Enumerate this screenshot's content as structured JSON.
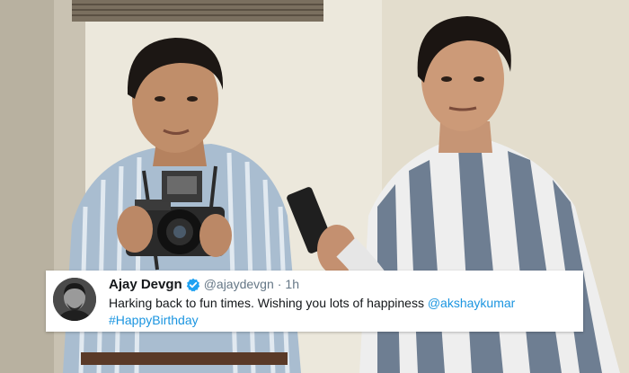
{
  "tweet": {
    "author_name": "Ajay Devgn",
    "handle": "@ajaydevgn",
    "separator": "·",
    "time": "1h",
    "text": "Harking back to fun times. Wishing you lots of happiness",
    "mention": "@akshaykumar",
    "hashtag": "#HappyBirthday"
  },
  "colors": {
    "link": "#1b95e0",
    "verified_badge": "#1da1f2",
    "card_background": "#ffffff",
    "name_text": "#14171a",
    "secondary_text": "#657786"
  },
  "icons": {
    "verified": "verified-badge-icon",
    "avatar": "profile-avatar"
  }
}
